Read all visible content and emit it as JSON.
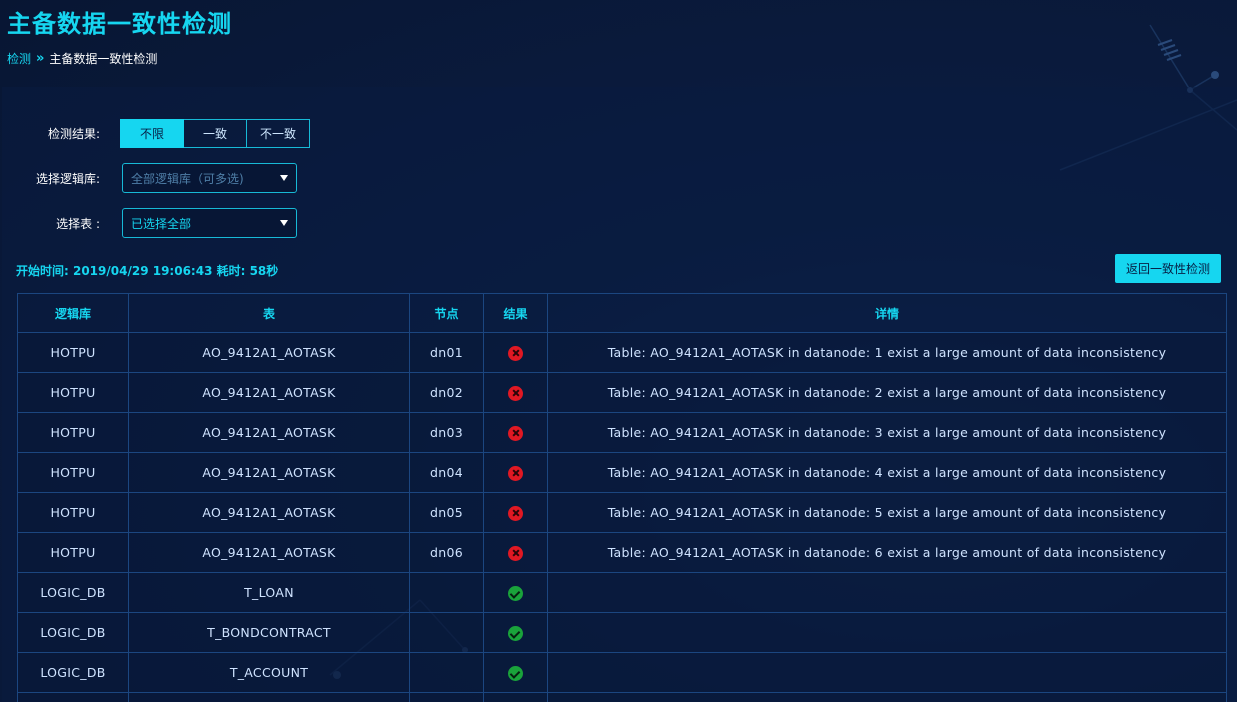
{
  "page_title": "主备数据一致性检测",
  "breadcrumb": {
    "parent": "检测",
    "separator": "»",
    "current": "主备数据一致性检测"
  },
  "filters": {
    "result_label": "检测结果:",
    "result_options": [
      "不限",
      "一致",
      "不一致"
    ],
    "result_selected": "不限",
    "db_label": "选择逻辑库:",
    "db_placeholder": "全部逻辑库（可多选)",
    "table_label": "选择表 :",
    "table_value": "已选择全部"
  },
  "meta": "开始时间: 2019/04/29 19:06:43 耗时: 58秒",
  "back_button": "返回一致性检测",
  "columns": [
    "逻辑库",
    "表",
    "节点",
    "结果",
    "详情"
  ],
  "rows": [
    {
      "db": "HOTPU",
      "table": "AO_9412A1_AOTASK",
      "node": "dn01",
      "result": "fail",
      "detail": "Table: AO_9412A1_AOTASK in datanode: 1 exist a large amount of data inconsistency"
    },
    {
      "db": "HOTPU",
      "table": "AO_9412A1_AOTASK",
      "node": "dn02",
      "result": "fail",
      "detail": "Table: AO_9412A1_AOTASK in datanode: 2 exist a large amount of data inconsistency"
    },
    {
      "db": "HOTPU",
      "table": "AO_9412A1_AOTASK",
      "node": "dn03",
      "result": "fail",
      "detail": "Table: AO_9412A1_AOTASK in datanode: 3 exist a large amount of data inconsistency"
    },
    {
      "db": "HOTPU",
      "table": "AO_9412A1_AOTASK",
      "node": "dn04",
      "result": "fail",
      "detail": "Table: AO_9412A1_AOTASK in datanode: 4 exist a large amount of data inconsistency"
    },
    {
      "db": "HOTPU",
      "table": "AO_9412A1_AOTASK",
      "node": "dn05",
      "result": "fail",
      "detail": "Table: AO_9412A1_AOTASK in datanode: 5 exist a large amount of data inconsistency"
    },
    {
      "db": "HOTPU",
      "table": "AO_9412A1_AOTASK",
      "node": "dn06",
      "result": "fail",
      "detail": "Table: AO_9412A1_AOTASK in datanode: 6 exist a large amount of data inconsistency"
    },
    {
      "db": "LOGIC_DB",
      "table": "T_LOAN",
      "node": "",
      "result": "ok",
      "detail": ""
    },
    {
      "db": "LOGIC_DB",
      "table": "T_BONDCONTRACT",
      "node": "",
      "result": "ok",
      "detail": ""
    },
    {
      "db": "LOGIC_DB",
      "table": "T_ACCOUNT",
      "node": "",
      "result": "ok",
      "detail": ""
    },
    {
      "db": "",
      "table": "",
      "node": "",
      "result": "",
      "detail": ""
    }
  ],
  "colors": {
    "accent": "#16d6f0",
    "fail": "#e01823",
    "ok": "#1aa33b",
    "background": "#0a1a3a"
  }
}
